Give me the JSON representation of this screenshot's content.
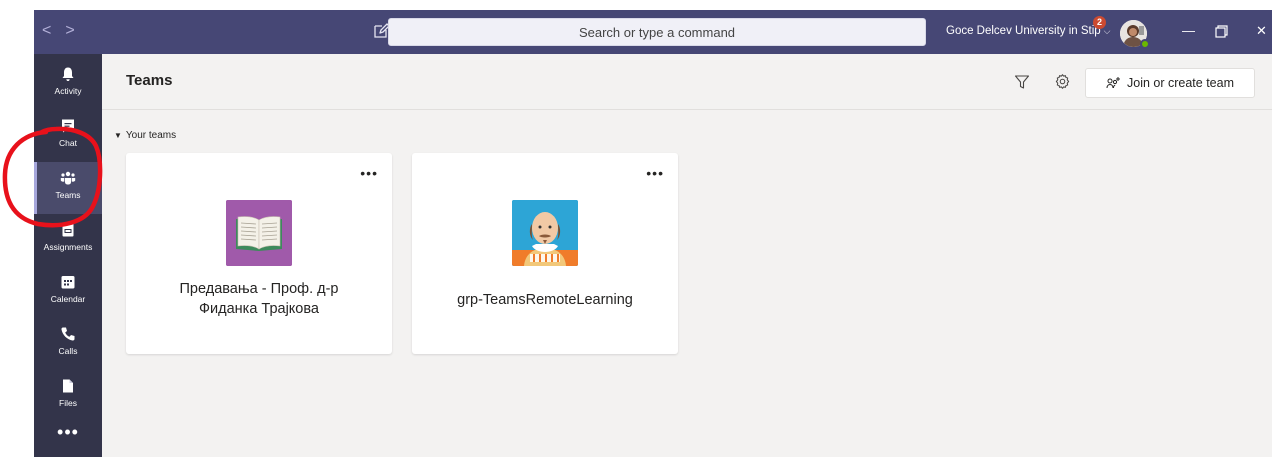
{
  "titlebar": {
    "back_glyph": "<",
    "forward_glyph": ">",
    "search_placeholder": "Search or type a command",
    "org_name": "Goce Delcev University in Stip",
    "notification_count": "2",
    "minimize_glyph": "—",
    "close_glyph": "✕"
  },
  "rail": {
    "items": [
      {
        "label": "Activity",
        "icon": "bell-icon"
      },
      {
        "label": "Chat",
        "icon": "chat-icon"
      },
      {
        "label": "Teams",
        "icon": "teams-icon"
      },
      {
        "label": "Assignments",
        "icon": "assignments-icon"
      },
      {
        "label": "Calendar",
        "icon": "calendar-icon"
      },
      {
        "label": "Calls",
        "icon": "phone-icon"
      },
      {
        "label": "Files",
        "icon": "file-icon"
      }
    ],
    "more_glyph": "•••"
  },
  "header": {
    "title": "Teams",
    "join_label": "Join or create team"
  },
  "section": {
    "label": "Your teams"
  },
  "teams": [
    {
      "name_line1": "Предавања - Проф. д-р",
      "name_line2": "Фиданка Трајкова",
      "icon": "book-icon",
      "thumb_color": "#a05aaa"
    },
    {
      "name": "grp-TeamsRemoteLearning",
      "icon": "shakespeare-icon",
      "thumb_color": "#2da5d6"
    }
  ],
  "card_more_glyph": "•••",
  "colors": {
    "titlebar": "#464775",
    "rail": "#33344a",
    "content_bg": "#f3f2f1",
    "annotation": "#e8111b"
  }
}
